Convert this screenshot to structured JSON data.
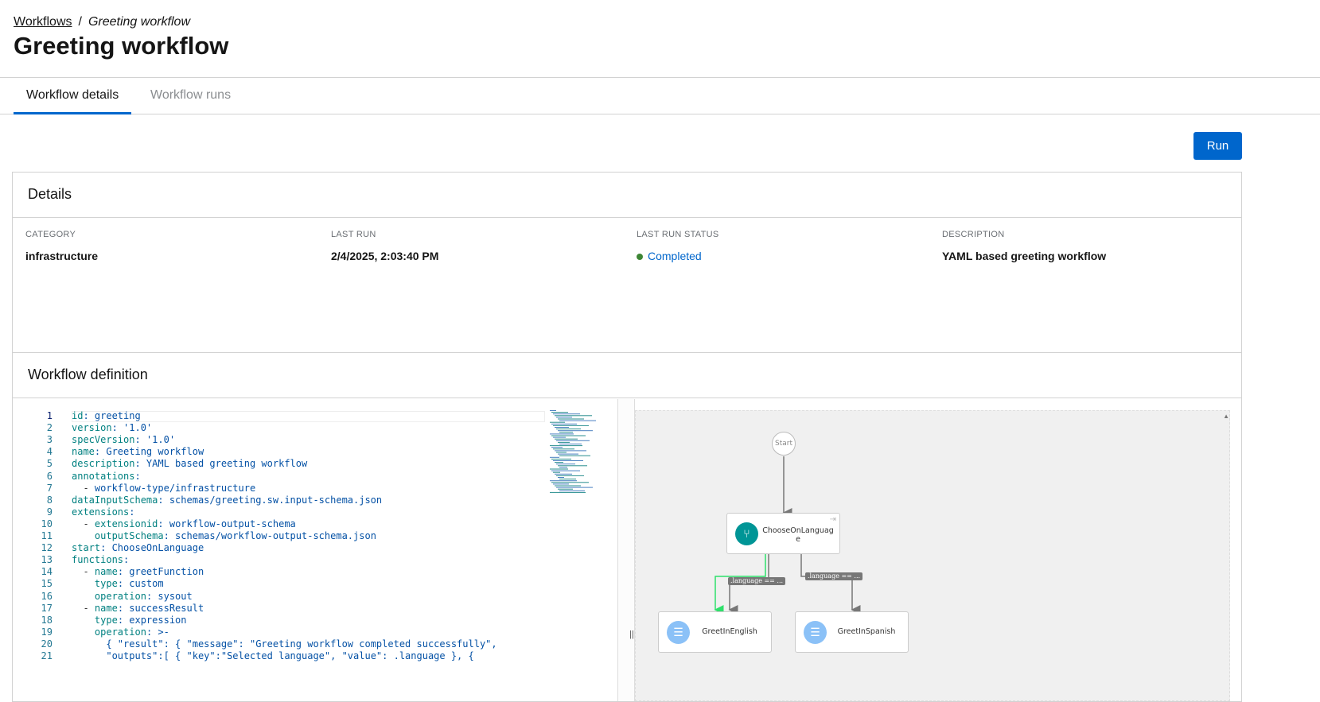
{
  "breadcrumb": {
    "parent": "Workflows",
    "current": "Greeting workflow"
  },
  "page_title": "Greeting workflow",
  "tabs": [
    {
      "label": "Workflow details"
    },
    {
      "label": "Workflow runs"
    }
  ],
  "run_label": "Run",
  "details": {
    "title": "Details",
    "fields": [
      {
        "label": "CATEGORY",
        "value": "infrastructure"
      },
      {
        "label": "LAST RUN",
        "value": "2/4/2025, 2:03:40 PM"
      },
      {
        "label": "LAST RUN STATUS",
        "value": "Completed",
        "status_color": "#3e8635"
      },
      {
        "label": "DESCRIPTION",
        "value": "YAML based greeting workflow"
      }
    ]
  },
  "definition": {
    "title": "Workflow definition",
    "lines": [
      {
        "n": "1",
        "indent": "",
        "key": "id",
        "val": ": greeting"
      },
      {
        "n": "2",
        "indent": "",
        "key": "version",
        "val": ": '1.0'"
      },
      {
        "n": "3",
        "indent": "",
        "key": "specVersion",
        "val": ": '1.0'"
      },
      {
        "n": "4",
        "indent": "",
        "key": "name",
        "val": ": Greeting workflow"
      },
      {
        "n": "5",
        "indent": "",
        "key": "description",
        "val": ": YAML based greeting workflow"
      },
      {
        "n": "6",
        "indent": "",
        "key": "annotations",
        "val": ":"
      },
      {
        "n": "7",
        "indent": "  - ",
        "key": "",
        "val": "workflow-type/infrastructure"
      },
      {
        "n": "8",
        "indent": "",
        "key": "dataInputSchema",
        "val": ": schemas/greeting.sw.input-schema.json"
      },
      {
        "n": "9",
        "indent": "",
        "key": "extensions",
        "val": ":"
      },
      {
        "n": "10",
        "indent": "  - ",
        "key": "extensionid",
        "val": ": workflow-output-schema"
      },
      {
        "n": "11",
        "indent": "    ",
        "key": "outputSchema",
        "val": ": schemas/workflow-output-schema.json"
      },
      {
        "n": "12",
        "indent": "",
        "key": "start",
        "val": ": ChooseOnLanguage"
      },
      {
        "n": "13",
        "indent": "",
        "key": "functions",
        "val": ":"
      },
      {
        "n": "14",
        "indent": "  - ",
        "key": "name",
        "val": ": greetFunction"
      },
      {
        "n": "15",
        "indent": "    ",
        "key": "type",
        "val": ": custom"
      },
      {
        "n": "16",
        "indent": "    ",
        "key": "operation",
        "val": ": sysout"
      },
      {
        "n": "17",
        "indent": "  - ",
        "key": "name",
        "val": ": successResult"
      },
      {
        "n": "18",
        "indent": "    ",
        "key": "type",
        "val": ": expression"
      },
      {
        "n": "19",
        "indent": "    ",
        "key": "operation",
        "val": ": >-"
      },
      {
        "n": "20",
        "indent": "      ",
        "key": "",
        "val": "{ \"result\": { \"message\": \"Greeting workflow completed successfully\","
      },
      {
        "n": "21",
        "indent": "      ",
        "key": "",
        "val": "\"outputs\":[ { \"key\":\"Selected language\", \"value\": .language }, {"
      }
    ]
  },
  "diagram": {
    "start": "Start",
    "nodes": [
      {
        "name": "ChooseOnLanguage"
      },
      {
        "name": "GreetInEnglish"
      },
      {
        "name": "GreetInSpanish"
      }
    ],
    "edge_labels": [
      ".language == ...",
      ".language == ..."
    ],
    "colors": {
      "switch": "#009596",
      "operation": "#8bc1f7",
      "default_edge": "#2ee06a"
    }
  }
}
